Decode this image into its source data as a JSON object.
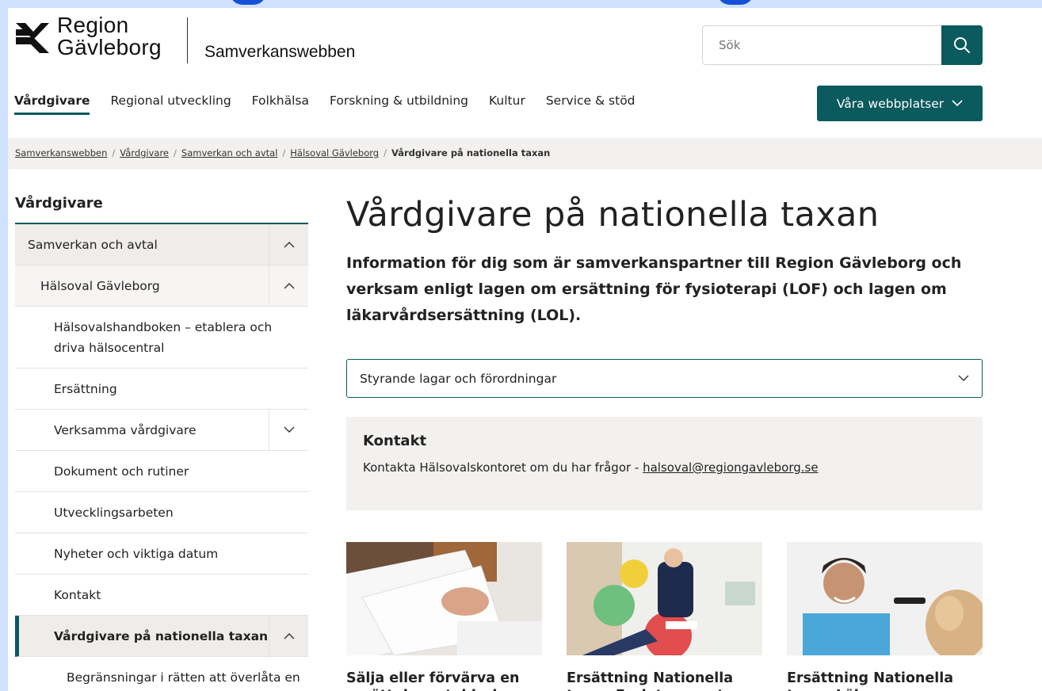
{
  "brand": {
    "logo_line1": "Region",
    "logo_line2": "Gävleborg",
    "site_name": "Samverkanswebben",
    "accent_color": "#0b5a5d",
    "logo_icon": "region-gavleborg-wave-icon"
  },
  "search": {
    "placeholder": "Sök",
    "icon": "search-icon"
  },
  "nav": {
    "items": [
      {
        "label": "Vårdgivare",
        "active": true
      },
      {
        "label": "Regional utveckling"
      },
      {
        "label": "Folkhälsa"
      },
      {
        "label": "Forskning & utbildning"
      },
      {
        "label": "Kultur"
      },
      {
        "label": "Service & stöd"
      }
    ],
    "sites_button": "Våra webbplatser"
  },
  "breadcrumb": {
    "items": [
      "Samverkanswebben",
      "Vårdgivare",
      "Samverkan och avtal",
      "Hälsoval Gävleborg"
    ],
    "current": "Vårdgivare på nationella taxan"
  },
  "sidebar": {
    "title": "Vårdgivare",
    "items": [
      {
        "label": "Samverkan och avtal",
        "level": 0,
        "toggle": "chevron-up-icon"
      },
      {
        "label": "Hälsoval Gävleborg",
        "level": 1,
        "toggle": "chevron-up-icon"
      },
      {
        "label": "Hälsovalshandboken – etablera och driva hälsocentral",
        "level": 2
      },
      {
        "label": "Ersättning",
        "level": 2
      },
      {
        "label": "Verksamma vårdgivare",
        "level": 2,
        "toggle": "chevron-down-icon"
      },
      {
        "label": "Dokument och rutiner",
        "level": 2
      },
      {
        "label": "Utvecklingsarbeten",
        "level": 2
      },
      {
        "label": "Nyheter och viktiga datum",
        "level": 2
      },
      {
        "label": "Kontakt",
        "level": 2
      },
      {
        "label": "Vårdgivare på nationella taxan",
        "level": 2,
        "active": true,
        "toggle": "chevron-up-icon"
      },
      {
        "label": "Begränsningar i rätten att överlåta en",
        "level": 3
      }
    ]
  },
  "main": {
    "title": "Vårdgivare på nationella taxan",
    "lead": "Information för dig som är samverkanspartner till Region Gävleborg och verksam enligt lagen om ersättning för fysioterapi (LOF) och lagen om läkarvårdsersättning (LOL).",
    "accordion_label": "Styrande lagar och förordningar",
    "contact": {
      "heading": "Kontakt",
      "text": "Kontakta Hälsovalskontoret om du har frågor - ",
      "email": "halsoval@regiongavleborg.se"
    },
    "cards": [
      {
        "title": "Sälja eller förvärva en ersättningsetablering",
        "image": "papers-in-hand-photo"
      },
      {
        "title": "Ersättning Nationella taxan Fysioterapeuter",
        "image": "physiotherapist-with-exercise-balls-photo"
      },
      {
        "title": "Ersättning Nationella taxan Läkare",
        "image": "doctor-examining-ear-photo"
      }
    ]
  }
}
